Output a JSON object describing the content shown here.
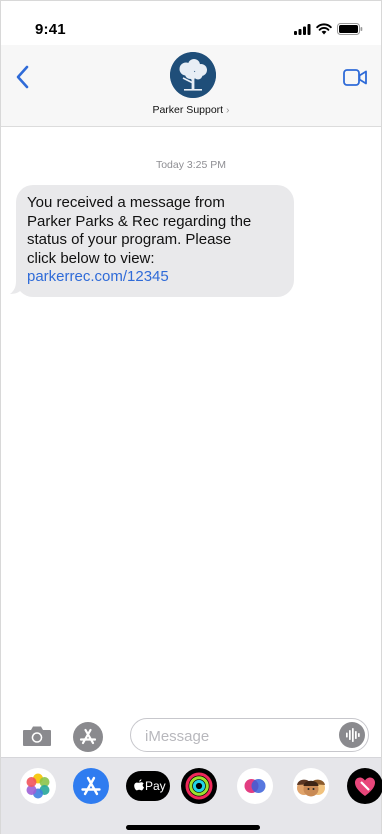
{
  "status_bar": {
    "time": "9:41",
    "icons": [
      "signal-icon",
      "wifi-icon",
      "battery-icon"
    ]
  },
  "header": {
    "contact_name": "Parker Support",
    "chevron": "›",
    "avatar_icon": "tree-logo-icon",
    "back_icon": "chevron-left-icon",
    "video_icon": "video-call-icon"
  },
  "conversation": {
    "timestamp": "Today 3:25 PM",
    "message_lines": [
      "You received a message from",
      "Parker Parks & Rec regarding the",
      "status of your program. Please",
      "click below to view:"
    ],
    "link": "parkerrec.com/12345"
  },
  "input": {
    "placeholder": "iMessage",
    "camera_icon": "camera-icon",
    "apps_icon": "app-store-icon",
    "audio_icon": "audio-waveform-icon"
  },
  "app_drawer": {
    "apps": [
      "photos-icon",
      "app-store-icon",
      "apple-pay-icon",
      "activity-icon",
      "digital-touch-icon",
      "memoji-icon",
      "heart-stickers-icon"
    ],
    "apple_pay_label": "Pay"
  },
  "colors": {
    "accent": "#2f6bd8",
    "bubble": "#e9e9eb",
    "avatar": "#1f4e79",
    "header_bg": "#f7f7f7"
  }
}
